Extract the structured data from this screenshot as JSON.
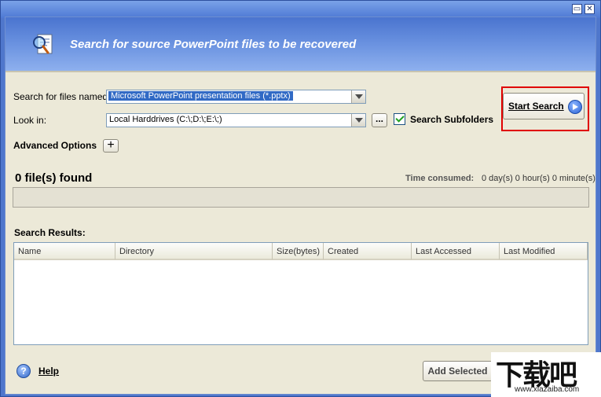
{
  "window": {
    "minimize_glyph": "▭",
    "close_glyph": "✕"
  },
  "banner": {
    "title": "Search for source PowerPoint files to be recovered",
    "icon": "search-document-icon"
  },
  "form": {
    "files_named_label": "Search for files named:",
    "files_named_value": "Microsoft PowerPoint presentation files (*.pptx)",
    "look_in_label": "Look in:",
    "look_in_value": "Local Harddrives (C:\\;D:\\;E:\\;)",
    "browse_label": "...",
    "subfolders_label": "Search Subfolders",
    "subfolders_checked": true,
    "advanced_label": "Advanced Options",
    "advanced_toggle": "+"
  },
  "start_button": {
    "label": "Start Search",
    "icon": "arrow-right-circle-icon"
  },
  "status": {
    "found_text": "0 file(s) found",
    "time_label": "Time consumed:",
    "time_value": "0 day(s) 0 hour(s) 0 minute(s)",
    "progress_fraction": 0.0
  },
  "results": {
    "label": "Search Results:",
    "columns": [
      "Name",
      "Directory",
      "Size(bytes)",
      "Created",
      "Last Accessed",
      "Last Modified"
    ],
    "rows": []
  },
  "footer": {
    "help_label": "Help",
    "help_icon_glyph": "?",
    "add_selected_label": "Add Selected"
  },
  "watermark": {
    "logo_text": "下载吧",
    "url": "www.xiazaiba.com"
  },
  "colors": {
    "title_bar": "#4e79d4",
    "banner_top": "#4a74cf",
    "panel": "#ece9d8",
    "selection": "#316ac5",
    "highlight_border": "#e00000",
    "progress_fill": "#3b79d8"
  }
}
